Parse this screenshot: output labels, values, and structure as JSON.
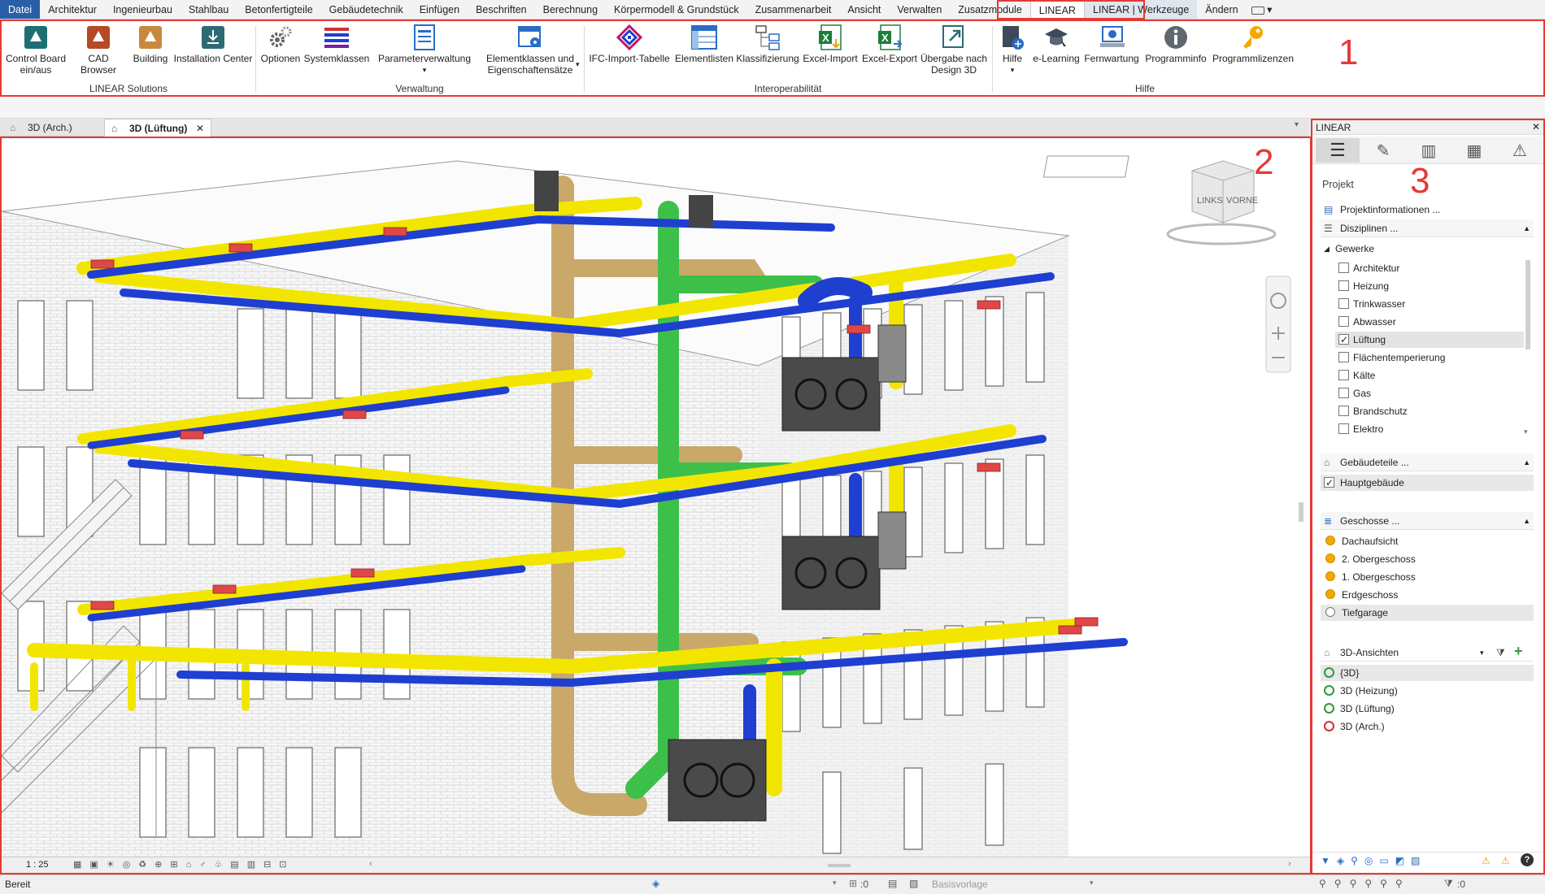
{
  "menu": {
    "tabs": [
      "Datei",
      "Architektur",
      "Ingenieurbau",
      "Stahlbau",
      "Betonfertigteile",
      "Gebäudetechnik",
      "Einfügen",
      "Beschriften",
      "Berechnung",
      "Körpermodell & Grundstück",
      "Zusammenarbeit",
      "Ansicht",
      "Verwalten",
      "Zusatzmodule",
      "LINEAR",
      "LINEAR | Werkzeuge",
      "Ändern"
    ]
  },
  "ribbon": {
    "solutions": {
      "label": "LINEAR Solutions",
      "buttons": [
        "Control Board ein/aus",
        "CAD Browser",
        "Building",
        "Installation Center"
      ]
    },
    "verwaltung": {
      "label": "Verwaltung",
      "buttons": [
        "Optionen",
        "Systemklassen",
        "Parameterverwaltung",
        "Elementklassen und Eigenschaftensätze"
      ]
    },
    "interop": {
      "label": "Interoperabilität",
      "buttons": [
        "IFC-Import-Tabelle",
        "Elementlisten",
        "Klassifizierung",
        "Excel-Import",
        "Excel-Export",
        "Übergabe nach Design 3D"
      ]
    },
    "hilfe": {
      "label": "Hilfe",
      "buttons": [
        "Hilfe",
        "e-Learning",
        "Fernwartung",
        "Programminfo",
        "Programmlizenzen"
      ]
    }
  },
  "callouts": {
    "one": "1",
    "two": "2",
    "three": "3"
  },
  "view_tabs": [
    {
      "label": "3D (Arch.)"
    },
    {
      "label": "3D (Lüftung)",
      "close": "✕"
    }
  ],
  "viewcube": {
    "left": "LINKS",
    "front": "VORNE"
  },
  "viewbar": {
    "scale": "1 : 25"
  },
  "panel": {
    "title": "LINEAR",
    "projekt_label": "Projekt",
    "projektinfo": "Projektinformationen ...",
    "disziplinen": "Disziplinen ...",
    "gewerke_label": "Gewerke",
    "gewerke": [
      {
        "name": "Architektur",
        "checked": false
      },
      {
        "name": "Heizung",
        "checked": false
      },
      {
        "name": "Trinkwasser",
        "checked": false
      },
      {
        "name": "Abwasser",
        "checked": false
      },
      {
        "name": "Lüftung",
        "checked": true
      },
      {
        "name": "Flächentemperierung",
        "checked": false
      },
      {
        "name": "Kälte",
        "checked": false
      },
      {
        "name": "Gas",
        "checked": false
      },
      {
        "name": "Brandschutz",
        "checked": false
      },
      {
        "name": "Elektro",
        "checked": false
      }
    ],
    "gebaeudeteile": "Gebäudeteile ...",
    "hauptgebaeude": "Hauptgebäude",
    "geschosse": "Geschosse ...",
    "geschoss_list": [
      "Dachaufsicht",
      "2. Obergeschoss",
      "1. Obergeschoss",
      "Erdgeschoss",
      "Tiefgarage"
    ],
    "ansichten": "3D-Ansichten",
    "ansicht_list": [
      {
        "name": "{3D}",
        "state": "ok"
      },
      {
        "name": "3D (Heizung)",
        "state": "ok"
      },
      {
        "name": "3D (Lüftung)",
        "state": "ok"
      },
      {
        "name": "3D (Arch.)",
        "state": "err"
      }
    ]
  },
  "status": {
    "left": "Bereit",
    "zero1": ":0",
    "template": "Basisvorlage",
    "zero2": ":0"
  },
  "colors": {
    "accent": "#e53935",
    "file_tab": "#2a5fa8",
    "duct_yellow": "#f2e600",
    "duct_blue": "#1f3fd1",
    "duct_green": "#3cc04a",
    "duct_tan": "#c9a86a"
  }
}
